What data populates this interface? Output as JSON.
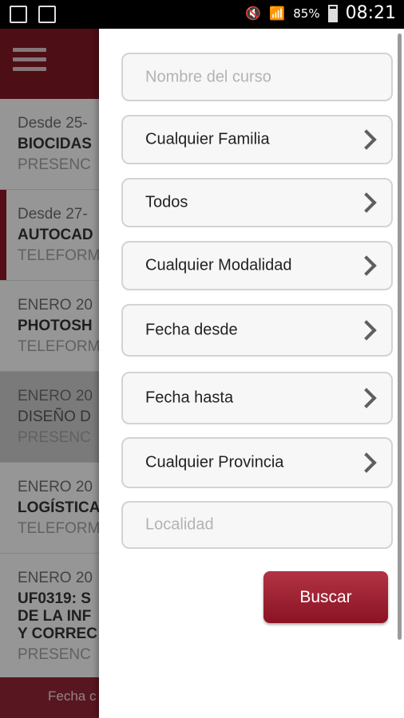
{
  "status_bar": {
    "battery": "85%",
    "time": "08:21"
  },
  "list_items": [
    {
      "date": "Desde 25-",
      "title": "BIOCIDAS",
      "mode": "PRESENC"
    },
    {
      "date": "Desde 27-",
      "title": "AUTOCAD",
      "mode": "TELEFORM"
    },
    {
      "date": "ENERO 20",
      "title": "PHOTOSH",
      "mode": "TELEFORM"
    },
    {
      "date": "ENERO 20",
      "title": "DISEÑO D",
      "mode": "PRESENC"
    },
    {
      "date": "ENERO 20",
      "title": "LOGÍSTICA",
      "mode": "TELEFORM"
    },
    {
      "date": "ENERO 20",
      "title_lines": [
        "UF0319: S",
        "DE LA INF",
        "Y CORREC"
      ],
      "mode": "PRESENC"
    }
  ],
  "bottom_bar": "Fecha c",
  "filters": {
    "course_name_placeholder": "Nombre del curso",
    "family": "Cualquier Familia",
    "todos": "Todos",
    "modality": "Cualquier Modalidad",
    "date_from": "Fecha desde",
    "date_to": "Fecha hasta",
    "province": "Cualquier Provincia",
    "locality_placeholder": "Localidad",
    "search_button": "Buscar"
  }
}
